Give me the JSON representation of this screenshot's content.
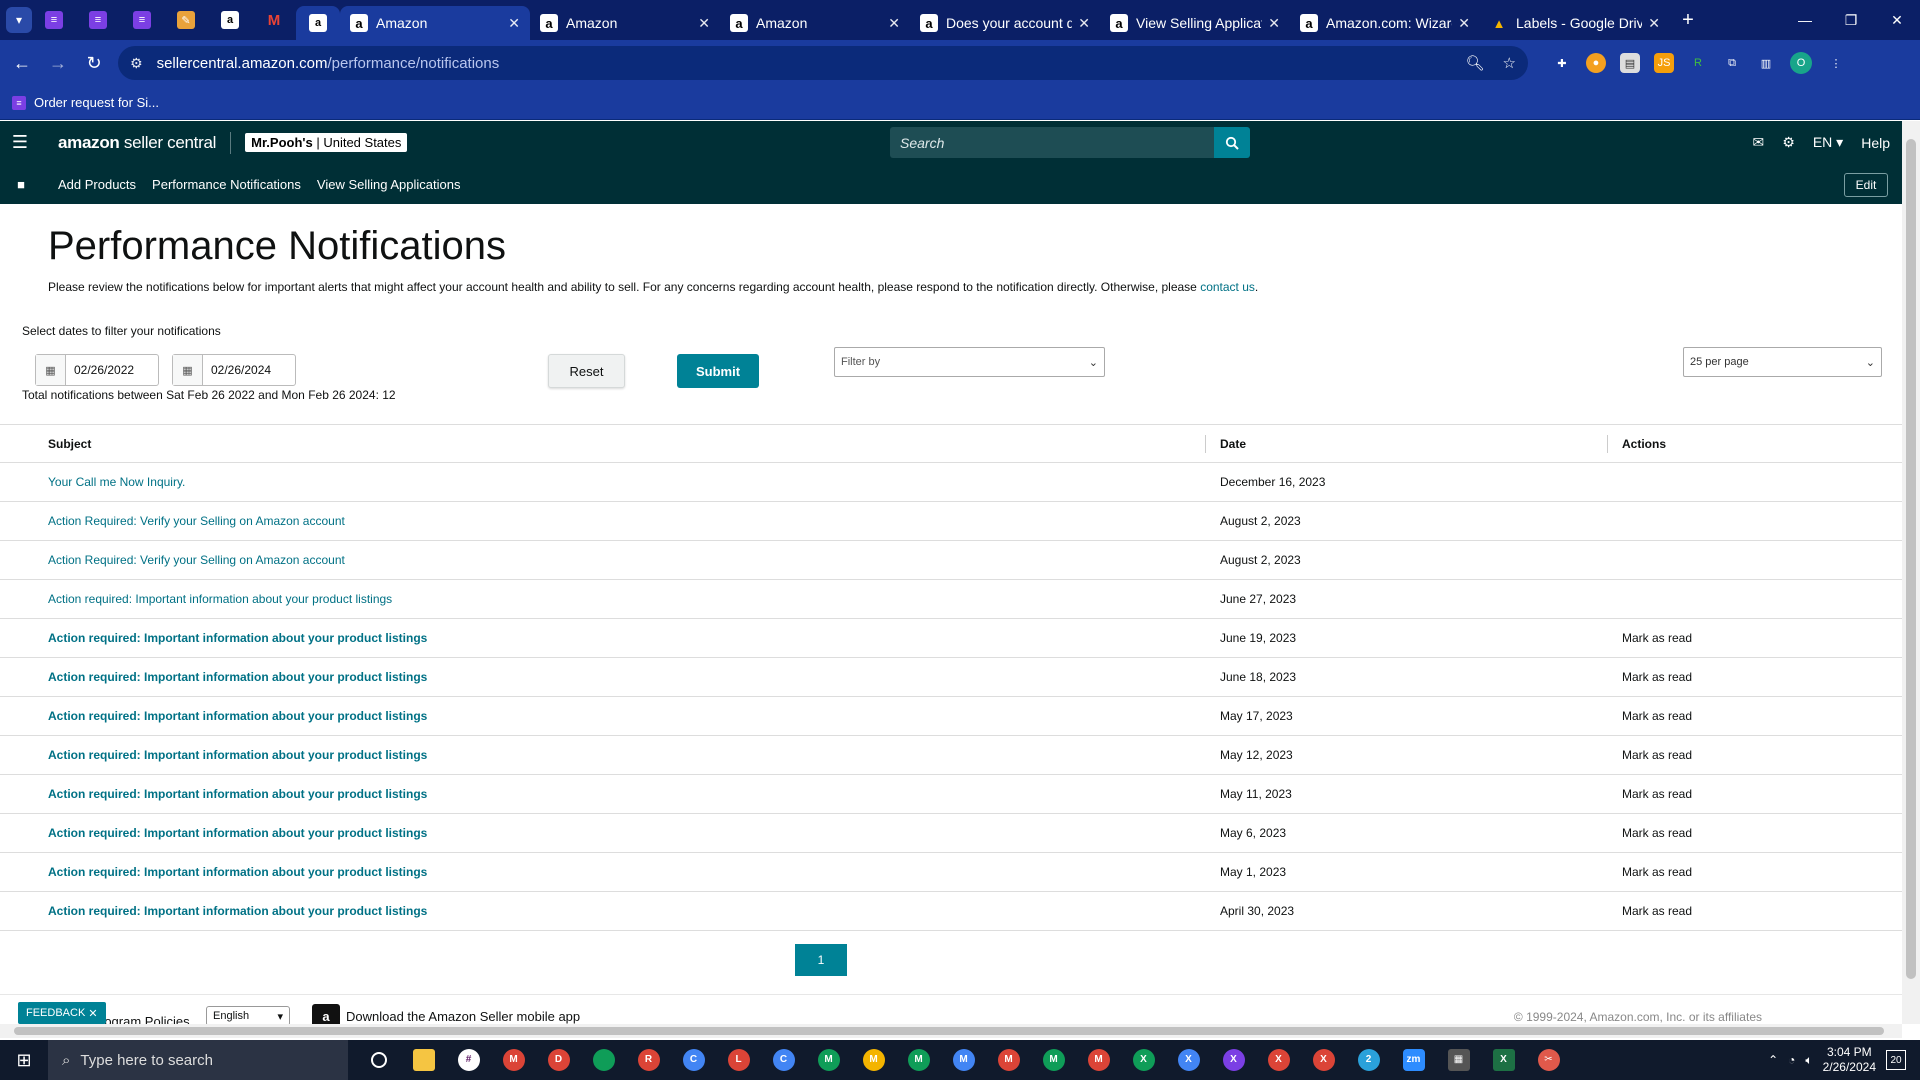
{
  "browser": {
    "tabs": [
      {
        "title": "Amazon",
        "active": true
      },
      {
        "title": "Amazon",
        "active": false
      },
      {
        "title": "Amazon",
        "active": false
      },
      {
        "title": "Does your account qu",
        "active": false
      },
      {
        "title": "View Selling Applicatio",
        "active": false
      },
      {
        "title": "Amazon.com: Wizard T",
        "active": false
      },
      {
        "title": "Labels - Google Drive",
        "active": false
      }
    ],
    "url_host": "sellercentral.amazon.com",
    "url_path": "/performance/notifications",
    "bookmark": "Order request for Si..."
  },
  "header": {
    "logo_bold": "amazon",
    "logo_rest": " seller central",
    "store_name": "Mr.Pooh's",
    "store_country": "United States",
    "search_placeholder": "Search",
    "lang": "EN",
    "help": "Help"
  },
  "subnav": {
    "items": [
      "Add Products",
      "Performance Notifications",
      "View Selling Applications"
    ],
    "edit": "Edit"
  },
  "page": {
    "title": "Performance Notifications",
    "intro": "Please review the notifications below for important alerts that might affect your account health and ability to sell. For any concerns regarding account health, please respond to the notification directly. Otherwise, please ",
    "intro_link": "contact us",
    "intro_end": ".",
    "filter_label": "Select dates to filter your notifications",
    "date_from": "02/26/2022",
    "date_to": "02/26/2024",
    "reset": "Reset",
    "submit": "Submit",
    "filter_by": "Filter by",
    "per_page": "25 per page",
    "total": "Total notifications between Sat Feb 26 2022 and Mon Feb 26 2024: 12"
  },
  "table": {
    "headers": [
      "Subject",
      "Date",
      "Actions"
    ],
    "rows": [
      {
        "subject": "Your Call me Now Inquiry.",
        "date": "December 16, 2023",
        "action": "",
        "unread": false
      },
      {
        "subject": "Action Required: Verify your Selling on Amazon account",
        "date": "August 2, 2023",
        "action": "",
        "unread": false
      },
      {
        "subject": "Action Required: Verify your Selling on Amazon account",
        "date": "August 2, 2023",
        "action": "",
        "unread": false
      },
      {
        "subject": "Action required: Important information about your product listings",
        "date": "June 27, 2023",
        "action": "",
        "unread": false
      },
      {
        "subject": "Action required: Important information about your product listings",
        "date": "June 19, 2023",
        "action": "Mark as read",
        "unread": true
      },
      {
        "subject": "Action required: Important information about your product listings",
        "date": "June 18, 2023",
        "action": "Mark as read",
        "unread": true
      },
      {
        "subject": "Action required: Important information about your product listings",
        "date": "May 17, 2023",
        "action": "Mark as read",
        "unread": true
      },
      {
        "subject": "Action required: Important information about your product listings",
        "date": "May 12, 2023",
        "action": "Mark as read",
        "unread": true
      },
      {
        "subject": "Action required: Important information about your product listings",
        "date": "May 11, 2023",
        "action": "Mark as read",
        "unread": true
      },
      {
        "subject": "Action required: Important information about your product listings",
        "date": "May 6, 2023",
        "action": "Mark as read",
        "unread": true
      },
      {
        "subject": "Action required: Important information about your product listings",
        "date": "May 1, 2023",
        "action": "Mark as read",
        "unread": true
      },
      {
        "subject": "Action required: Important information about your product listings",
        "date": "April 30, 2023",
        "action": "Mark as read",
        "unread": true
      }
    ]
  },
  "pagination": {
    "current": "1"
  },
  "footer": {
    "feedback": "FEEDBACK",
    "program_policies": "rogram Policies",
    "language": "English",
    "app": "Download the Amazon Seller mobile app",
    "copyright": "© 1999-2024, Amazon.com, Inc. or its affiliates"
  },
  "taskbar": {
    "search_placeholder": "Type here to search",
    "time": "3:04 PM",
    "date": "2/26/2024",
    "notifications": "20"
  },
  "colors": {
    "teal_header": "#002f36",
    "accent": "#008296",
    "link": "#007185",
    "browser_chrome": "#1a3b9e"
  }
}
